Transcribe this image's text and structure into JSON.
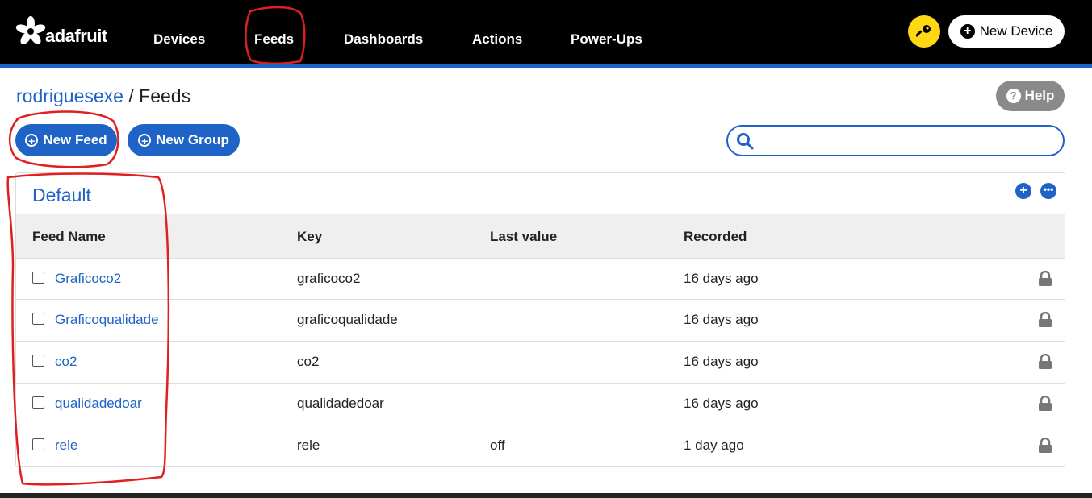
{
  "header": {
    "logo_text": "adafruit",
    "nav": [
      "Devices",
      "Feeds",
      "Dashboards",
      "Actions",
      "Power-Ups"
    ],
    "new_device_label": "New Device"
  },
  "breadcrumb": {
    "user": "rodriguesexe",
    "separator": " / ",
    "page": "Feeds"
  },
  "help_label": "Help",
  "buttons": {
    "new_feed": "New Feed",
    "new_group": "New Group"
  },
  "search": {
    "value": "",
    "placeholder": ""
  },
  "group": {
    "title": "Default",
    "columns": [
      "Feed Name",
      "Key",
      "Last value",
      "Recorded"
    ],
    "rows": [
      {
        "name": "Graficoco2",
        "key": "graficoco2",
        "last_value": "",
        "recorded": "16 days ago"
      },
      {
        "name": "Graficoqualidade",
        "key": "graficoqualidade",
        "last_value": "",
        "recorded": "16 days ago"
      },
      {
        "name": "co2",
        "key": "co2",
        "last_value": "",
        "recorded": "16 days ago"
      },
      {
        "name": "qualidadedoar",
        "key": "qualidadedoar",
        "last_value": "",
        "recorded": "16 days ago"
      },
      {
        "name": "rele",
        "key": "rele",
        "last_value": "off",
        "recorded": "1 day ago"
      }
    ]
  },
  "colors": {
    "accent": "#1f63c6",
    "topbar": "#000000",
    "key_button": "#ffd814",
    "annotation": "#e0201e"
  }
}
